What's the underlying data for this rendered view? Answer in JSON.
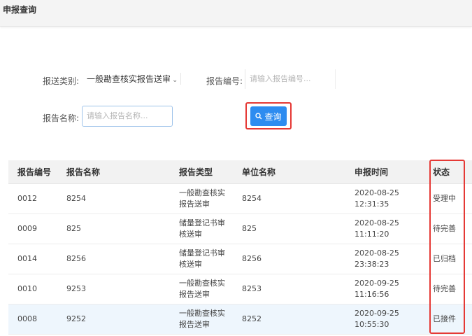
{
  "header": {
    "title": "申报查询"
  },
  "filters": {
    "report_type_label": "报送类别:",
    "report_type_value": "一般勘查核实报告送审",
    "report_no_label": "报告编号:",
    "report_no_placeholder": "请输入报告编号...",
    "report_name_label": "报告名称:",
    "report_name_placeholder": "请输入报告名称..."
  },
  "query_button": {
    "label": "查询"
  },
  "table": {
    "columns": [
      "报告编号",
      "报告名称",
      "报告类型",
      "单位名称",
      "申报时间",
      "状态"
    ],
    "rows": [
      {
        "no": "0012",
        "name": "8254",
        "type1": "一般勘查核实",
        "type2": "报告送审",
        "unit": "8254",
        "time": "2020-08-25 12:31:35",
        "status": "受理中"
      },
      {
        "no": "0009",
        "name": "825",
        "type1": "储量登记书审",
        "type2": "核送审",
        "unit": "825",
        "time": "2020-08-25 11:11:20",
        "status": "待完善"
      },
      {
        "no": "0014",
        "name": "8256",
        "type1": "储量登记书审",
        "type2": "核送审",
        "unit": "8256",
        "time": "2020-08-25 23:38:23",
        "status": "已归档"
      },
      {
        "no": "0010",
        "name": "9253",
        "type1": "一般勘查核实",
        "type2": "报告送审",
        "unit": "8253",
        "time": "2020-09-25 11:16:56",
        "status": "待完善"
      },
      {
        "no": "0008",
        "name": "9252",
        "type1": "一般勘查核实",
        "type2": "报告送审",
        "unit": "8252",
        "time": "2020-09-25 10:55:30",
        "status": "已接件"
      }
    ]
  }
}
